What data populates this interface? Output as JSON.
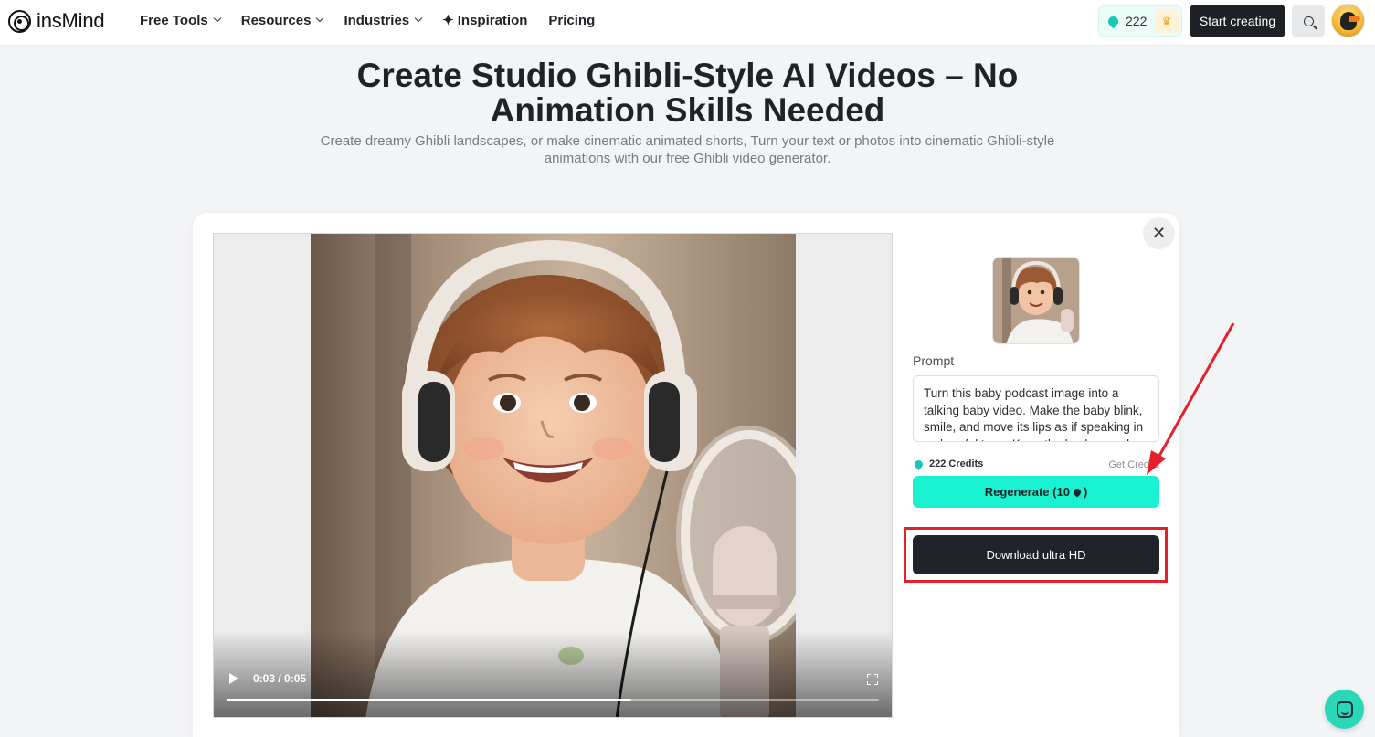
{
  "nav": {
    "logo_text": "insMind",
    "menu": [
      {
        "label": "Free Tools",
        "dropdown": true
      },
      {
        "label": "Resources",
        "dropdown": true
      },
      {
        "label": "Industries",
        "dropdown": true
      },
      {
        "label": "Inspiration",
        "dropdown": false
      },
      {
        "label": "Pricing",
        "dropdown": false
      }
    ],
    "credits_count": "222",
    "start_label": "Start creating"
  },
  "hero": {
    "title": "Create Studio Ghibli-Style AI Videos – No Animation Skills Needed",
    "subtitle": "Create dreamy Ghibli landscapes, or make cinematic animated shorts, Turn your text or photos into cinematic Ghibli-style animations with our free Ghibli video generator."
  },
  "modal": {
    "close_glyph": "✕",
    "video": {
      "time": "0:03 / 0:05",
      "progress": 0.62
    },
    "prompt_label": "Prompt",
    "prompt_value": "Turn this baby podcast image into a talking baby video. Make the baby blink, smile, and move its lips as if speaking in a cheerful tone. Keep the background and headphones the same.",
    "credits_text": "222 Credits",
    "get_credits": "Get Credits",
    "regenerate_label": "Regenerate (10",
    "regenerate_suffix": ")",
    "download_label": "Download ultra HD"
  },
  "colors": {
    "accent": "#19f2d1",
    "dark": "#20242a",
    "annotation": "#e5202a"
  },
  "icons": [
    "chevron-down-icon",
    "sparkle-icon",
    "gem-icon",
    "crown-icon",
    "search-icon",
    "close-icon",
    "play-icon",
    "fullscreen-icon",
    "chat-icon"
  ]
}
